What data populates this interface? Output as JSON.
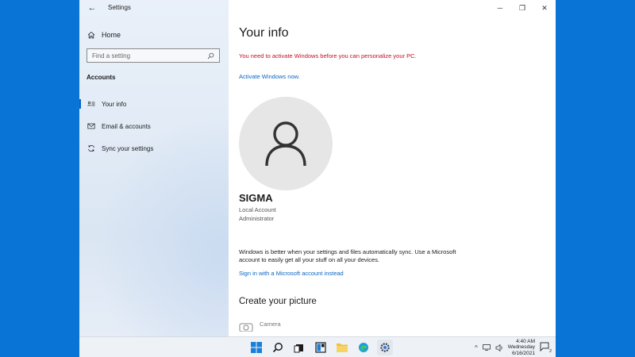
{
  "window": {
    "app_title": "Settings",
    "controls": {
      "minimize": "─",
      "maximize": "❐",
      "close": "✕"
    }
  },
  "sidebar": {
    "back_glyph": "←",
    "home_label": "Home",
    "search_placeholder": "Find a setting",
    "section_label": "Accounts",
    "items": [
      {
        "label": "Your info",
        "icon": "person-card-icon",
        "active": true
      },
      {
        "label": "Email & accounts",
        "icon": "mail-icon",
        "active": false
      },
      {
        "label": "Sync your settings",
        "icon": "sync-icon",
        "active": false
      }
    ]
  },
  "main": {
    "title": "Your info",
    "warning": "You need to activate Windows before you can personalize your PC.",
    "activate_link": "Activate Windows now.",
    "user": {
      "name": "SIGMA",
      "account_type": "Local Account",
      "role": "Administrator"
    },
    "sync_text": "Windows is better when your settings and files automatically sync. Use a Microsoft account to easily get all your stuff on all your devices.",
    "sign_in_link": "Sign in with a Microsoft account instead",
    "create_picture_heading": "Create your picture",
    "camera_label": "Camera"
  },
  "taskbar": {
    "apps": [
      "start-icon",
      "search-icon",
      "task-view-icon",
      "widgets-icon",
      "file-explorer-icon",
      "edge-icon",
      "settings-icon"
    ],
    "tray": {
      "chevron": "^",
      "time": "4:40 AM",
      "day": "Wednesday",
      "date": "6/16/2021",
      "notification_count": "2"
    }
  },
  "colors": {
    "desktop": "#0a74d6",
    "accent": "#0a66c2",
    "warning": "#c50f1f"
  }
}
